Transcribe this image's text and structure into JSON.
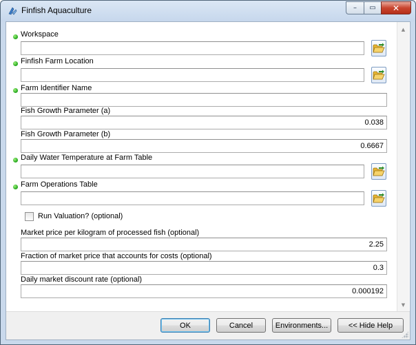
{
  "window": {
    "title": "Finfish Aquaculture",
    "minimize_glyph": "–",
    "maximize_glyph": "▭",
    "close_glyph": "✕"
  },
  "fields": {
    "workspace": {
      "label": "Workspace",
      "value": "",
      "required": true
    },
    "farm_location": {
      "label": "Finfish Farm Location",
      "value": "",
      "required": true
    },
    "farm_identifier": {
      "label": "Farm Identifier Name",
      "value": "",
      "required": true
    },
    "growth_a": {
      "label": "Fish Growth Parameter (a)",
      "value": "0.038",
      "required": false
    },
    "growth_b": {
      "label": "Fish Growth Parameter (b)",
      "value": "0.6667",
      "required": false
    },
    "water_temp_table": {
      "label": "Daily Water Temperature at Farm Table",
      "value": "",
      "required": true
    },
    "farm_ops_table": {
      "label": "Farm Operations Table",
      "value": "",
      "required": true
    },
    "run_valuation": {
      "label": "Run Valuation? (optional)",
      "checked": false
    },
    "market_price": {
      "label": "Market price per kilogram of processed fish (optional)",
      "value": "2.25"
    },
    "cost_fraction": {
      "label": "Fraction of market price that accounts for costs (optional)",
      "value": "0.3"
    },
    "discount_rate": {
      "label": "Daily market discount rate (optional)",
      "value": "0.000192"
    }
  },
  "buttons": {
    "ok": "OK",
    "cancel": "Cancel",
    "environments": "Environments...",
    "hide_help": "<< Hide Help"
  },
  "scroll": {
    "up_glyph": "▲",
    "down_glyph": "▼"
  },
  "colors": {
    "required_dot": "#1fa21a",
    "folder_icon": "#e8b632",
    "folder_arrow": "#2f8f2a",
    "titlebar": "#c6d7ec",
    "close_button": "#c9452f"
  },
  "icons": {
    "app": "toolbox-icon",
    "browse": "open-folder-icon"
  }
}
